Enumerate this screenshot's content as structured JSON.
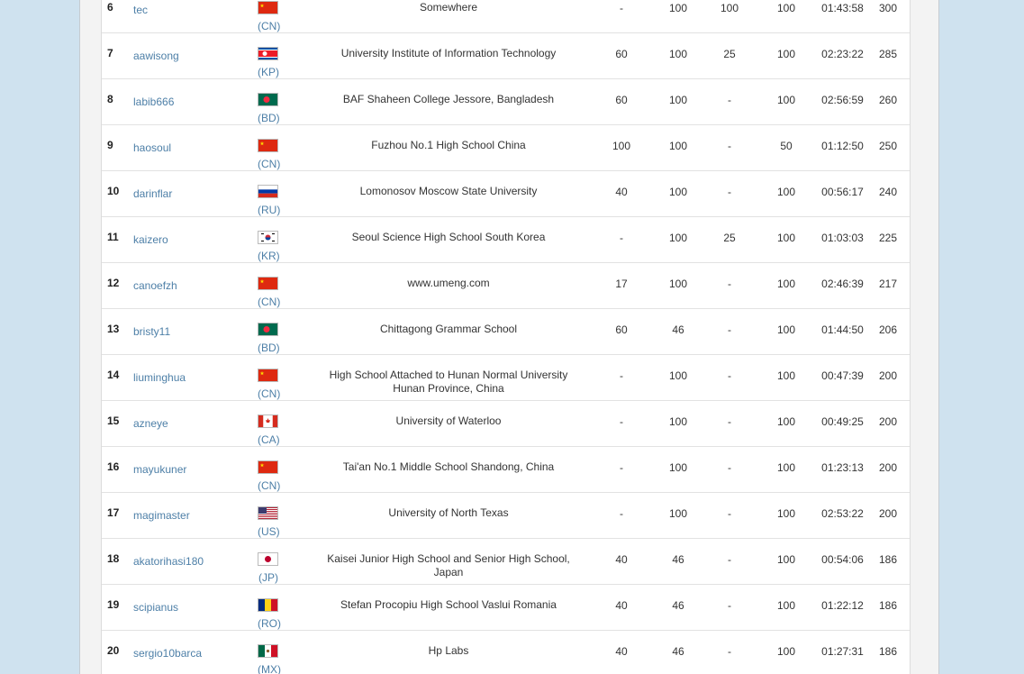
{
  "rows": [
    {
      "rank": "6",
      "user": "tec",
      "country": "CN",
      "school": "Somewhere",
      "p1": "-",
      "p2": "100",
      "p3": "100",
      "p4": "100",
      "time": "01:43:58",
      "score": "300"
    },
    {
      "rank": "7",
      "user": "aawisong",
      "country": "KP",
      "school": "University Institute of Information Technology",
      "p1": "60",
      "p2": "100",
      "p3": "25",
      "p4": "100",
      "time": "02:23:22",
      "score": "285"
    },
    {
      "rank": "8",
      "user": "labib666",
      "country": "BD",
      "school": "BAF Shaheen College Jessore, Bangladesh",
      "p1": "60",
      "p2": "100",
      "p3": "-",
      "p4": "100",
      "time": "02:56:59",
      "score": "260"
    },
    {
      "rank": "9",
      "user": "haosoul",
      "country": "CN",
      "school": "Fuzhou No.1 High School China",
      "p1": "100",
      "p2": "100",
      "p3": "-",
      "p4": "50",
      "time": "01:12:50",
      "score": "250"
    },
    {
      "rank": "10",
      "user": "darinflar",
      "country": "RU",
      "school": "Lomonosov Moscow State University",
      "p1": "40",
      "p2": "100",
      "p3": "-",
      "p4": "100",
      "time": "00:56:17",
      "score": "240"
    },
    {
      "rank": "11",
      "user": "kaizero",
      "country": "KR",
      "school": "Seoul Science High School South Korea",
      "p1": "-",
      "p2": "100",
      "p3": "25",
      "p4": "100",
      "time": "01:03:03",
      "score": "225"
    },
    {
      "rank": "12",
      "user": "canoefzh",
      "country": "CN",
      "school": "www.umeng.com",
      "p1": "17",
      "p2": "100",
      "p3": "-",
      "p4": "100",
      "time": "02:46:39",
      "score": "217"
    },
    {
      "rank": "13",
      "user": "bristy11",
      "country": "BD",
      "school": "Chittagong Grammar School",
      "p1": "60",
      "p2": "46",
      "p3": "-",
      "p4": "100",
      "time": "01:44:50",
      "score": "206"
    },
    {
      "rank": "14",
      "user": "liuminghua",
      "country": "CN",
      "school": "High School Attached to Hunan Normal University Hunan Province, China",
      "p1": "-",
      "p2": "100",
      "p3": "-",
      "p4": "100",
      "time": "00:47:39",
      "score": "200"
    },
    {
      "rank": "15",
      "user": "azneye",
      "country": "CA",
      "school": "University of Waterloo",
      "p1": "-",
      "p2": "100",
      "p3": "-",
      "p4": "100",
      "time": "00:49:25",
      "score": "200"
    },
    {
      "rank": "16",
      "user": "mayukuner",
      "country": "CN",
      "school": "Tai'an No.1 Middle School Shandong, China",
      "p1": "-",
      "p2": "100",
      "p3": "-",
      "p4": "100",
      "time": "01:23:13",
      "score": "200"
    },
    {
      "rank": "17",
      "user": "magimaster",
      "country": "US",
      "school": "University of North Texas",
      "p1": "-",
      "p2": "100",
      "p3": "-",
      "p4": "100",
      "time": "02:53:22",
      "score": "200"
    },
    {
      "rank": "18",
      "user": "akatorihasi180",
      "country": "JP",
      "school": "Kaisei Junior High School and Senior High School, Japan",
      "p1": "40",
      "p2": "46",
      "p3": "-",
      "p4": "100",
      "time": "00:54:06",
      "score": "186"
    },
    {
      "rank": "19",
      "user": "scipianus",
      "country": "RO",
      "school": "Stefan Procopiu High School Vaslui Romania",
      "p1": "40",
      "p2": "46",
      "p3": "-",
      "p4": "100",
      "time": "01:22:12",
      "score": "186"
    },
    {
      "rank": "20",
      "user": "sergio10barca",
      "country": "MX",
      "school": "Hp Labs",
      "p1": "40",
      "p2": "46",
      "p3": "-",
      "p4": "100",
      "time": "01:27:31",
      "score": "186"
    }
  ]
}
